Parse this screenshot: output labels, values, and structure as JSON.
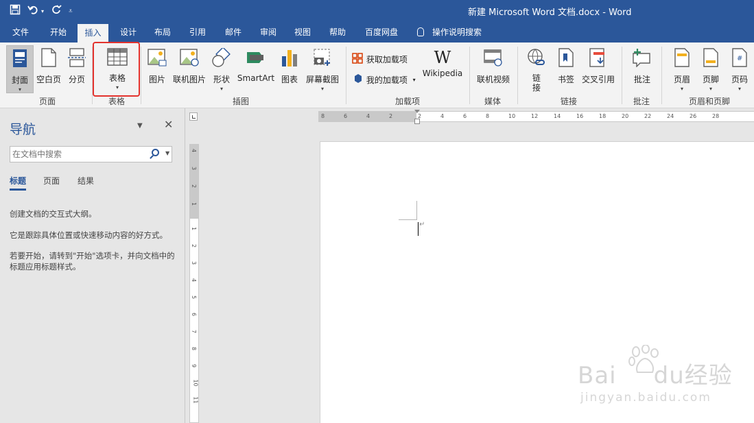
{
  "window": {
    "title": "新建 Microsoft Word 文档.docx  -  Word"
  },
  "qat": {
    "save_icon": "save-icon",
    "undo_icon": "undo-icon",
    "redo_icon": "redo-icon",
    "customize_icon": "customize-qat-icon"
  },
  "tabs": [
    {
      "label": "文件"
    },
    {
      "label": "开始"
    },
    {
      "label": "插入"
    },
    {
      "label": "设计"
    },
    {
      "label": "布局"
    },
    {
      "label": "引用"
    },
    {
      "label": "邮件"
    },
    {
      "label": "审阅"
    },
    {
      "label": "视图"
    },
    {
      "label": "帮助"
    },
    {
      "label": "百度网盘"
    },
    {
      "label": "操作说明搜索"
    }
  ],
  "active_tab": "插入",
  "ribbon": {
    "pages": {
      "cover": "封面",
      "blank": "空白页",
      "break": "分页",
      "group": "页面"
    },
    "tables": {
      "table": "表格",
      "group": "表格"
    },
    "illustrations": {
      "picture": "图片",
      "online_picture": "联机图片",
      "shapes": "形状",
      "smartart": "SmartArt",
      "chart": "图表",
      "screenshot": "屏幕截图",
      "group": "插图"
    },
    "addins": {
      "get_addins": "获取加载项",
      "my_addins": "我的加载项",
      "wikipedia": "Wikipedia",
      "group": "加载项"
    },
    "media": {
      "online_video": "联机视频",
      "group": "媒体"
    },
    "links": {
      "link": "链接",
      "bookmark": "书签",
      "cross_ref": "交叉引用",
      "group": "链接"
    },
    "comments": {
      "comment": "批注",
      "group": "批注"
    },
    "header_footer": {
      "header": "页眉",
      "footer": "页脚",
      "page_number": "页码",
      "group": "页眉和页脚"
    }
  },
  "nav": {
    "title": "导航",
    "search_placeholder": "在文档中搜索",
    "tabs": [
      "标题",
      "页面",
      "结果"
    ],
    "line1": "创建文档的交互式大纲。",
    "line2": "它是跟踪具体位置或快速移动内容的好方式。",
    "line3": "若要开始，请转到\"开始\"选项卡，并向文档中的标题应用标题样式。"
  },
  "ruler": {
    "h_ticks": [
      "8",
      "6",
      "4",
      "2",
      "2",
      "4",
      "6",
      "8",
      "10",
      "12",
      "14",
      "16",
      "18",
      "20",
      "22",
      "24",
      "26",
      "28"
    ],
    "v_ticks": [
      "4",
      "3",
      "2",
      "1",
      "1",
      "2",
      "3",
      "4",
      "5",
      "6",
      "7",
      "8",
      "9",
      "10",
      "11"
    ]
  },
  "watermark": {
    "brand": "Bai",
    "brand2": "du",
    "brand3": "经验",
    "url": "jingyan.baidu.com"
  },
  "colors": {
    "accent": "#2b579a",
    "highlight": "#e3322d"
  }
}
